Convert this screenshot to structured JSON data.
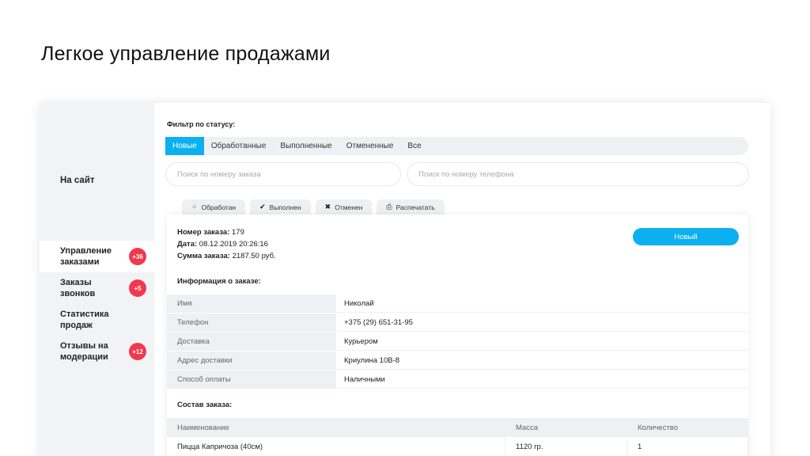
{
  "page_title": "Легкое управление продажами",
  "sidebar": {
    "site_link": "На сайт",
    "items": [
      {
        "label": "Управление заказами",
        "badge": "+36",
        "active": true
      },
      {
        "label": "Заказы звонков",
        "badge": "+5",
        "active": false
      },
      {
        "label": "Статистика продаж",
        "badge": "",
        "active": false
      },
      {
        "label": "Отзывы на модерации",
        "badge": "+12",
        "active": false
      }
    ]
  },
  "filter": {
    "label": "Фильтр по статусу:",
    "tabs": [
      "Новые",
      "Обработанные",
      "Выполненные",
      "Отмененные",
      "Все"
    ],
    "active_tab": "Новые"
  },
  "search": {
    "order_placeholder": "Поиск по номеру заказа",
    "phone_placeholder": "Поиск по номеру телефона"
  },
  "actions": [
    {
      "label": "Обработан",
      "icon": "spinner-icon"
    },
    {
      "label": "Выполнен",
      "icon": "check-icon"
    },
    {
      "label": "Отменен",
      "icon": "close-icon"
    },
    {
      "label": "Распечатать",
      "icon": "printer-icon"
    }
  ],
  "order": {
    "number_label": "Номер заказа:",
    "number": "179",
    "date_label": "Дата:",
    "date": "08.12.2019 20:26:16",
    "sum_label": "Сумма заказа:",
    "sum": "2187.50 руб.",
    "status": "Новый",
    "info_title": "Информация о заказе:",
    "info": [
      {
        "key": "Имя",
        "value": "Николай"
      },
      {
        "key": "Телефон",
        "value": "+375 (29) 651-31-95"
      },
      {
        "key": "Доставка",
        "value": "Курьером"
      },
      {
        "key": "Адрес доставки",
        "value": "Криулина 10В-8"
      },
      {
        "key": "Способ оплаты",
        "value": "Наличными"
      }
    ],
    "composition_title": "Состав заказа:",
    "composition_headers": [
      "Наименование",
      "Масса",
      "Количество"
    ],
    "composition_rows": [
      [
        "Пицца Капричоза (40см)",
        "1120 гр.",
        "1"
      ]
    ]
  },
  "colors": {
    "accent": "#0bb0f0",
    "badge": "#f0394f",
    "panel": "#eef0f4"
  }
}
